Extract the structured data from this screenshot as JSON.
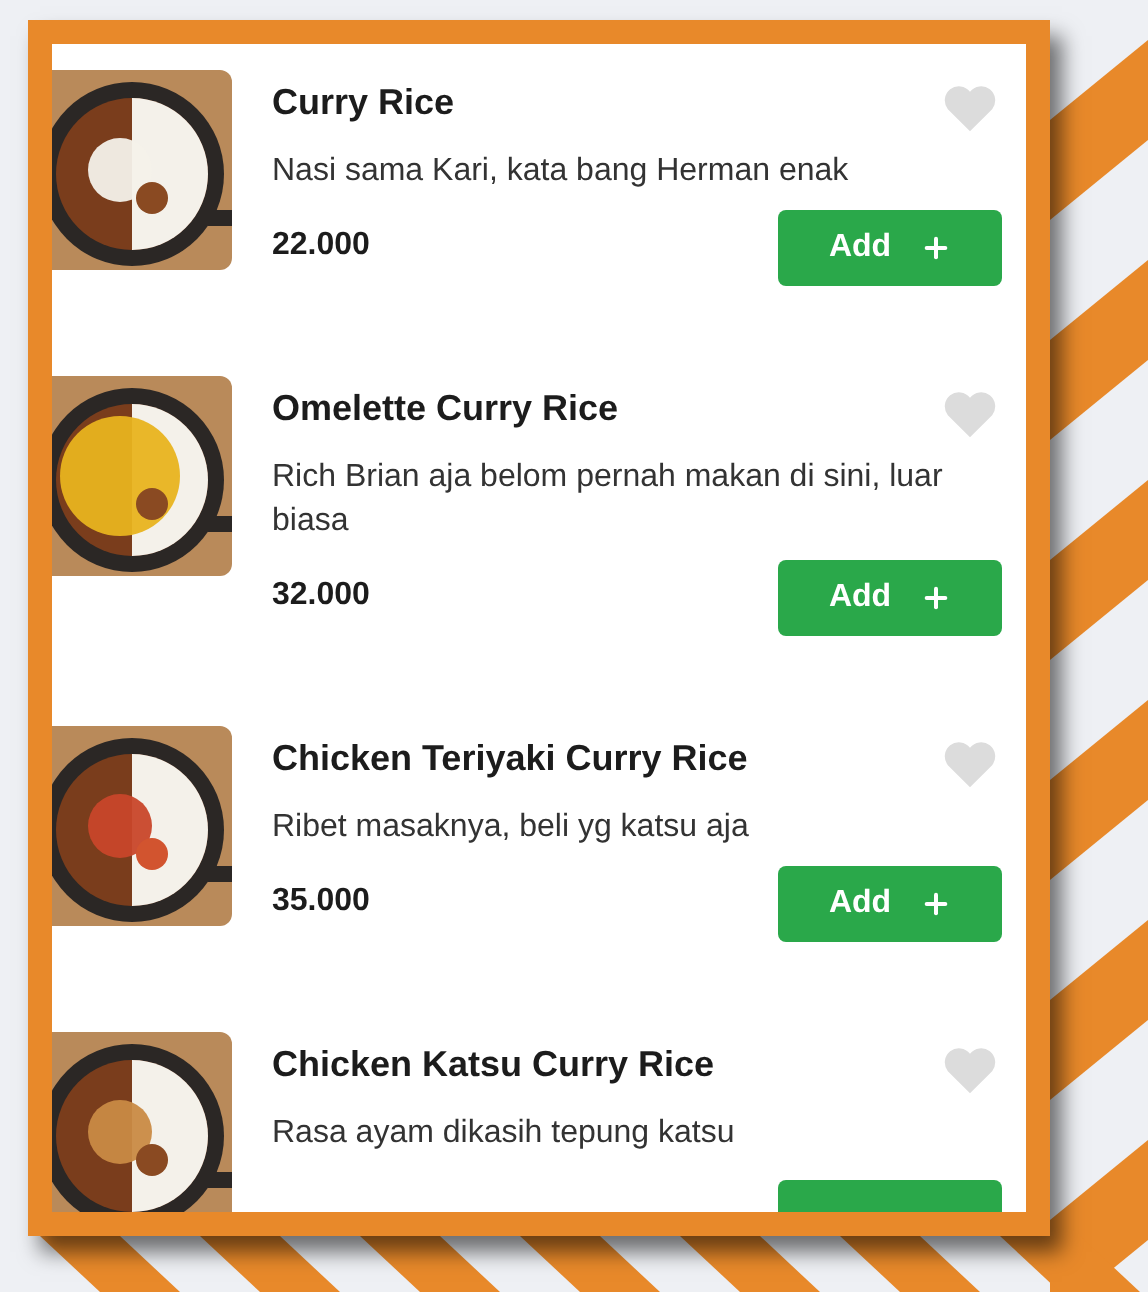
{
  "menu_items": [
    {
      "name": "Curry Rice",
      "description": "Nasi sama Kari, kata bang Herman enak",
      "price": "22.000",
      "favorite": false,
      "button_label": "Add"
    },
    {
      "name": "Omelette Curry Rice",
      "description": "Rich Brian aja belom pernah makan di sini, luar biasa",
      "price": "32.000",
      "favorite": false,
      "button_label": "Add"
    },
    {
      "name": "Chicken Teriyaki Curry Rice",
      "description": "Ribet masaknya, beli yg katsu aja",
      "price": "35.000",
      "favorite": false,
      "button_label": "Add"
    },
    {
      "name": "Chicken Katsu Curry Rice",
      "description": "Rasa ayam dikasih tepung katsu",
      "favorite": false
    }
  ]
}
